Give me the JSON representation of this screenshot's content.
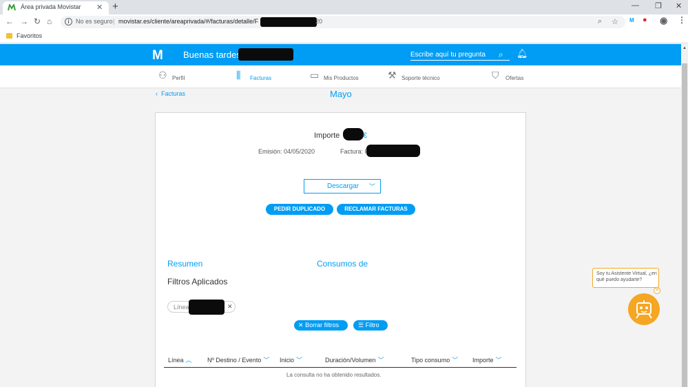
{
  "browser": {
    "tab_title": "Área privada Movistar",
    "tab_close": "✕",
    "new_tab": "+",
    "not_secure": "No es seguro",
    "url": "movistar.es/cliente/areaprivada/#/facturas/detalle/F",
    "url_tail": "20",
    "bookmark_folder": "Favoritos"
  },
  "header": {
    "logo": "M",
    "greeting": "Buenas tardes",
    "search_placeholder": "Escribe aquí tu pregunta"
  },
  "nav": {
    "items": [
      {
        "label": "Perfil",
        "icon": "user-icon"
      },
      {
        "label": "Facturas",
        "icon": "bars-icon"
      },
      {
        "label": "Mis Productos",
        "icon": "devices-icon"
      },
      {
        "label": "Soporte técnico",
        "icon": "wrench-icon"
      },
      {
        "label": "Ofertas",
        "icon": "bag-icon"
      }
    ],
    "active": "Facturas"
  },
  "page": {
    "back_label": "Facturas",
    "month": "Mayo"
  },
  "invoice": {
    "importe_label": "Importe",
    "currency": "€",
    "emision_label": "Emisión: 04/05/2020",
    "factura_label": "Factura: F",
    "download_label": "Descargar",
    "pedir_duplicado": "PEDIR DUPLICADO",
    "reclamar_facturas": "RECLAMAR FACTURAS"
  },
  "filters": {
    "resumen_label": "Resumen",
    "consumos_label": "Consumos de",
    "applied_title": "Filtros Aplicados",
    "chip_label": "Línea",
    "clear_label": "Borrar filtros",
    "filter_label": "Filtro"
  },
  "table": {
    "columns": [
      "Línea",
      "Nº Destino / Evento",
      "Inicio",
      "Duración/Volumen",
      "Tipo consumo",
      "Importe"
    ],
    "empty_message": "La consulta no ha obtenido resultados."
  },
  "assistant": {
    "bubble_text": "Soy tu Asistente Virtual, ¿en qué puedo ayudarte?"
  },
  "colors": {
    "brand": "#019df4",
    "assistant": "#f5a623"
  }
}
